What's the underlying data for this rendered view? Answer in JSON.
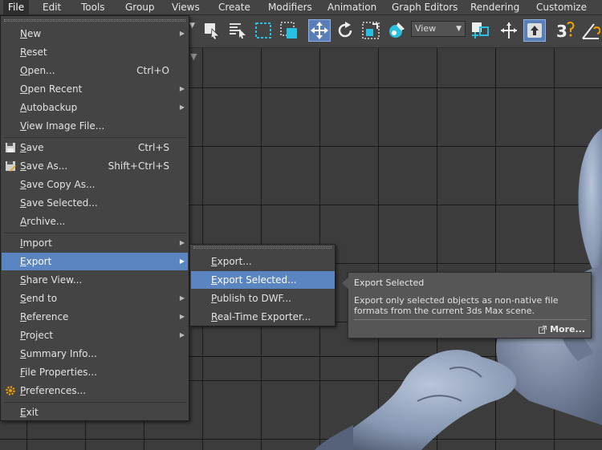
{
  "menubar": {
    "items": [
      "File",
      "Edit",
      "Tools",
      "Group",
      "Views",
      "Create",
      "Modifiers",
      "Animation",
      "Graph Editors",
      "Rendering",
      "Customize"
    ]
  },
  "toolbar": {
    "view_select": "View",
    "snap_label": "3",
    "icons": [
      "select-object-icon",
      "select-by-name-icon",
      "rectangular-selection-icon",
      "window-crossing-icon",
      "select-move-icon",
      "select-rotate-icon",
      "select-scale-icon",
      "select-place-icon",
      "use-pivot-icon",
      "select-manipulate-icon",
      "keyboard-shortcut-override-icon",
      "snaps-toggle-icon",
      "angle-snap-icon"
    ]
  },
  "file_menu": {
    "items": [
      {
        "label": "New",
        "shortcut": "",
        "submenu": true
      },
      {
        "label": "Reset",
        "shortcut": "",
        "submenu": false
      },
      {
        "label": "Open...",
        "shortcut": "Ctrl+O",
        "submenu": false
      },
      {
        "label": "Open Recent",
        "shortcut": "",
        "submenu": true
      },
      {
        "label": "Autobackup",
        "shortcut": "",
        "submenu": true
      },
      {
        "label": "View Image File...",
        "shortcut": "",
        "submenu": false
      },
      {
        "label": "Save",
        "shortcut": "Ctrl+S",
        "submenu": false,
        "icon": "save-icon"
      },
      {
        "label": "Save As...",
        "shortcut": "Shift+Ctrl+S",
        "submenu": false,
        "icon": "save-as-icon"
      },
      {
        "label": "Save Copy As...",
        "shortcut": "",
        "submenu": false
      },
      {
        "label": "Save Selected...",
        "shortcut": "",
        "submenu": false
      },
      {
        "label": "Archive...",
        "shortcut": "",
        "submenu": false
      },
      {
        "label": "Import",
        "shortcut": "",
        "submenu": true
      },
      {
        "label": "Export",
        "shortcut": "",
        "submenu": true,
        "highlighted": true
      },
      {
        "label": "Share View...",
        "shortcut": "",
        "submenu": false
      },
      {
        "label": "Send to",
        "shortcut": "",
        "submenu": true
      },
      {
        "label": "Reference",
        "shortcut": "",
        "submenu": true
      },
      {
        "label": "Project",
        "shortcut": "",
        "submenu": true
      },
      {
        "label": "Summary Info...",
        "shortcut": "",
        "submenu": false
      },
      {
        "label": "File Properties...",
        "shortcut": "",
        "submenu": false
      },
      {
        "label": "Preferences...",
        "shortcut": "",
        "submenu": false,
        "icon": "gear-icon"
      },
      {
        "label": "Exit",
        "shortcut": "",
        "submenu": false
      }
    ]
  },
  "export_menu": {
    "items": [
      {
        "label": "Export..."
      },
      {
        "label": "Export Selected...",
        "highlighted": true
      },
      {
        "label": "Publish to DWF..."
      },
      {
        "label": "Real-Time Exporter..."
      }
    ]
  },
  "tooltip": {
    "title": "Export Selected",
    "description": "Export only selected objects as non-native file formats from the current 3ds Max scene.",
    "more": "More..."
  },
  "colors": {
    "highlight": "#5b85c1",
    "menu_bg": "#444444",
    "viewport_bg": "#3c3c3c",
    "model": "#8c9bb5"
  }
}
